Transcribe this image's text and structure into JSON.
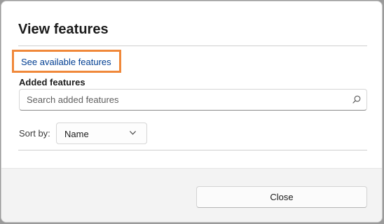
{
  "dialog": {
    "title": "View features"
  },
  "link": {
    "label": "See available features",
    "highlight_color": "#f0883a"
  },
  "added_features": {
    "label": "Added features",
    "search_placeholder": "Search added features",
    "search_value": "",
    "search_icon": "search-icon"
  },
  "sort": {
    "label": "Sort by:",
    "selected": "Name",
    "icon": "chevron-down-icon"
  },
  "footer": {
    "close_label": "Close"
  }
}
